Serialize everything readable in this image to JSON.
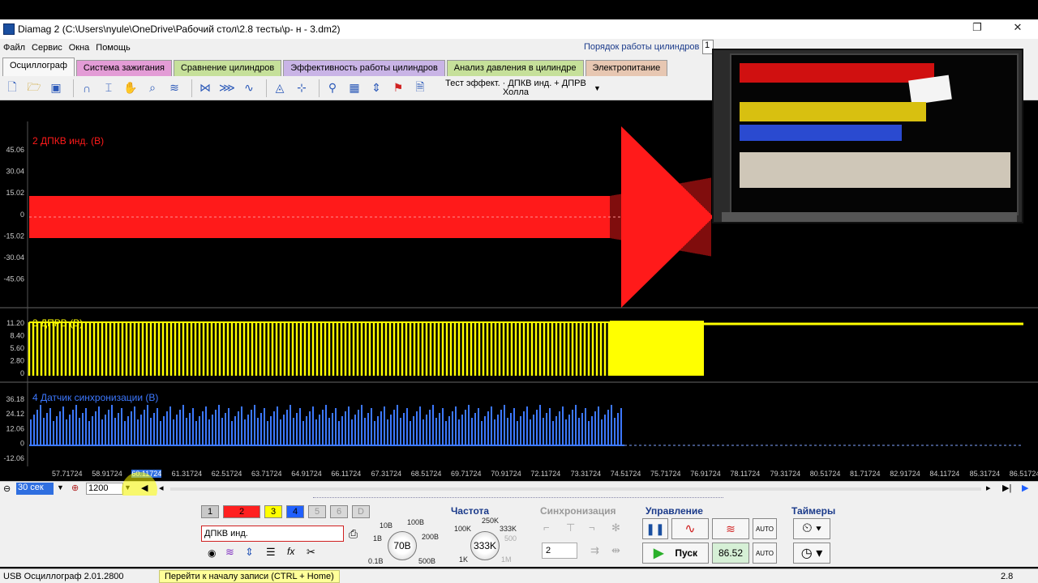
{
  "window": {
    "title": "Diamag 2 (C:\\Users\\nyule\\OneDrive\\Рабочий стол\\2.8 тесты\\р- н - 3.dm2)"
  },
  "menu": [
    "Файл",
    "Сервис",
    "Окна",
    "Помощь"
  ],
  "cylinder_order": {
    "label": "Порядок работы цилиндров",
    "value": "1"
  },
  "tabs": [
    {
      "label": "Осциллограф",
      "color": "#f8f8f8"
    },
    {
      "label": "Система зажигания",
      "color": "#e39cd6"
    },
    {
      "label": "Сравнение цилиндров",
      "color": "#c6e09a"
    },
    {
      "label": "Эффективность работы цилиндров",
      "color": "#c9b4e6"
    },
    {
      "label": "Анализ давления в цилиндре",
      "color": "#c6e09a"
    },
    {
      "label": "Электропитание",
      "color": "#e7c7b2"
    }
  ],
  "toolbar": {
    "test_combo": "Тест эффект. · ДПКВ инд. + ДПРВ Холла"
  },
  "channels": [
    {
      "label": "2 ДПКВ инд. (В)",
      "color": "#ff1a1a",
      "ticks": [
        "45.06",
        "30.04",
        "15.02",
        "0",
        "-15.02",
        "-30.04",
        "-45.06"
      ]
    },
    {
      "label": "3 ДПРВ (В)",
      "color": "#ffff00",
      "ticks": [
        "11.20",
        "8.40",
        "5.60",
        "2.80",
        "0"
      ]
    },
    {
      "label": "4 Датчик синхронизации (В)",
      "color": "#3c78ff",
      "ticks": [
        "36.18",
        "24.12",
        "12.06",
        "0",
        "-12.06"
      ]
    }
  ],
  "x_ticks": [
    "57.71724",
    "58.91724",
    "60.11724",
    "61.31724",
    "62.51724",
    "63.71724",
    "64.91724",
    "66.11724",
    "67.31724",
    "68.51724",
    "69.71724",
    "70.91724",
    "72.11724",
    "73.31724",
    "74.51724",
    "75.71724",
    "76.91724",
    "78.11724",
    "79.31724",
    "80.51724",
    "81.71724",
    "82.91724",
    "84.11724",
    "85.31724",
    "86.51724"
  ],
  "scroll": {
    "timebase": "30 сек",
    "points": "1200"
  },
  "channel_buttons": [
    {
      "label": "1",
      "color": "#c8c8c8"
    },
    {
      "label": "2",
      "color": "#ff2020"
    },
    {
      "label": "3",
      "color": "#ffff00"
    },
    {
      "label": "4",
      "color": "#2060ff"
    },
    {
      "label": "5",
      "color": "#d8d8d8"
    },
    {
      "label": "6",
      "color": "#d8d8d8"
    },
    {
      "label": "D",
      "color": "#d8d8d8"
    }
  ],
  "sensor_field": "ДПКВ инд.",
  "voltage_dial": {
    "value": "70В",
    "labels": [
      "10В",
      "100В",
      "1В",
      "200В",
      "0.1В",
      "500В"
    ]
  },
  "frequency": {
    "title": "Частота",
    "value": "333K",
    "labels": [
      "250K",
      "100K",
      "333K",
      "500",
      "1K",
      "1M"
    ]
  },
  "sync": {
    "title": "Синхронизация",
    "value": "2"
  },
  "control": {
    "title": "Управление",
    "start_label": "Пуск",
    "readout": "86.52",
    "auto": "AUTO"
  },
  "timers": {
    "title": "Таймеры"
  },
  "status": {
    "left": "USB Осциллограф  2.01.2800",
    "tip": "Перейти к началу записи (CTRL + Home)",
    "right": "2.8"
  }
}
